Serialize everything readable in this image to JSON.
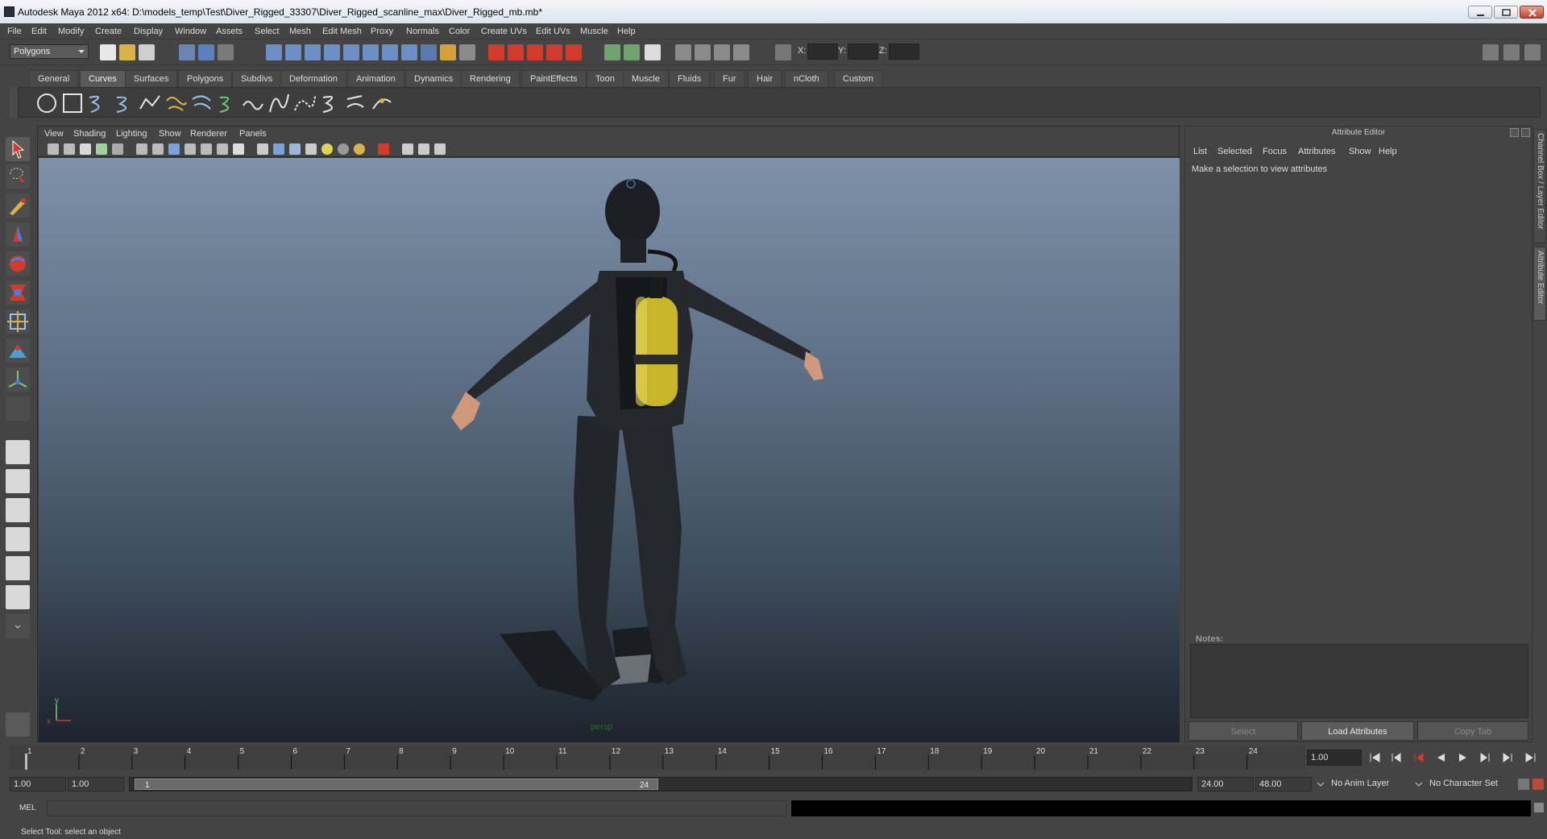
{
  "window": {
    "title": "Autodesk Maya 2012 x64: D:\\models_temp\\Test\\Diver_Rigged_33307\\Diver_Rigged_scanline_max\\Diver_Rigged_mb.mb*"
  },
  "menubar": [
    "File",
    "Edit",
    "Modify",
    "Create",
    "Display",
    "Window",
    "Assets",
    "Select",
    "Mesh",
    "Edit Mesh",
    "Proxy",
    "Normals",
    "Color",
    "Create UVs",
    "Edit UVs",
    "Muscle",
    "Help"
  ],
  "status_line": {
    "mode": "Polygons",
    "coords": {
      "x_label": "X:",
      "y_label": "Y:",
      "z_label": "Z:"
    }
  },
  "shelf": {
    "tabs": [
      "General",
      "Curves",
      "Surfaces",
      "Polygons",
      "Subdivs",
      "Deformation",
      "Animation",
      "Dynamics",
      "Rendering",
      "PaintEffects",
      "Toon",
      "Muscle",
      "Fluids",
      "Fur",
      "Hair",
      "nCloth",
      "Custom"
    ],
    "active_tab": "Curves",
    "icons": [
      "nurbs-circle-icon",
      "nurbs-square-icon",
      "cv-curve-icon",
      "ep-curve-icon",
      "linear-curve-icon",
      "pencil-curve-icon",
      "arc-curve-icon",
      "attach-curves-icon",
      "detach-curves-icon",
      "rebuild-curve-icon",
      "offset-curve-icon",
      "fillet-curve-icon",
      "extend-curve-icon",
      "insert-knot-icon"
    ]
  },
  "viewport": {
    "menu": [
      "View",
      "Shading",
      "Lighting",
      "Show",
      "Renderer",
      "Panels"
    ],
    "camera_label": "persp",
    "axis": {
      "x": "x",
      "y": "y"
    }
  },
  "attribute_editor": {
    "title": "Attribute Editor",
    "menu": [
      "List",
      "Selected",
      "Focus",
      "Attributes",
      "Show",
      "Help"
    ],
    "message": "Make a selection to view attributes",
    "notes_label": "Notes:",
    "buttons": {
      "select": "Select",
      "load": "Load Attributes",
      "copy": "Copy Tab"
    }
  },
  "side_tabs": [
    "Channel Box / Layer Editor",
    "Attribute Editor"
  ],
  "timeline": {
    "ticks": [
      "1",
      "2",
      "3",
      "4",
      "5",
      "6",
      "7",
      "8",
      "9",
      "10",
      "11",
      "12",
      "13",
      "14",
      "15",
      "16",
      "17",
      "18",
      "19",
      "20",
      "21",
      "22",
      "23",
      "24"
    ],
    "current_time": "1.00"
  },
  "range": {
    "start_time": "1.00",
    "playback_start": "1.00",
    "range_start": "1",
    "range_end": "24",
    "playback_end": "24.00",
    "end_time": "48.00",
    "anim_layer": "No Anim Layer",
    "character_set": "No Character Set"
  },
  "command_line": {
    "label": "MEL"
  },
  "help_line": "Select Tool: select an object",
  "colors": {
    "bg": "#444444",
    "viewport_top": "#7d91a8",
    "viewport_bottom": "#1c232c",
    "tank": "#c9b52a",
    "accent_red": "#d23a2a"
  }
}
